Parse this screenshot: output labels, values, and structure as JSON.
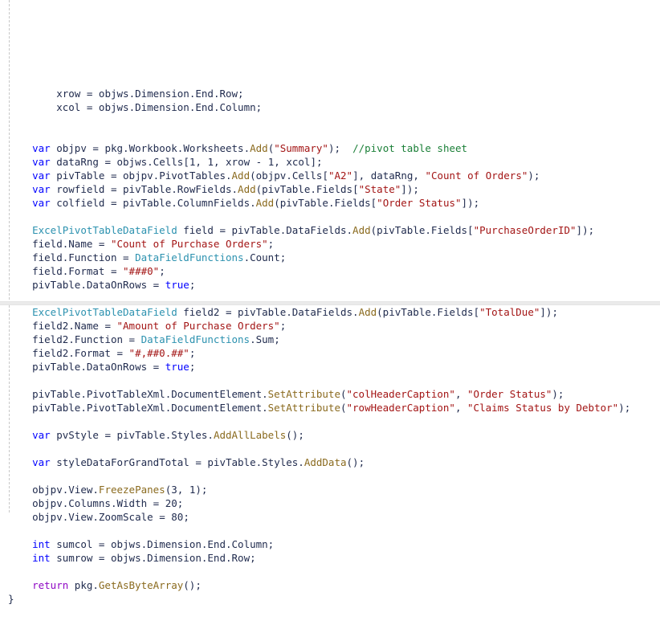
{
  "editor": {
    "language": "csharp",
    "background_color": "#ffffff",
    "indent_guide_color": "#c8c8c8",
    "region_divider_color": "#ebebeb",
    "colors": {
      "keyword": "#0000ff",
      "control_keyword": "#8f08c4",
      "type": "#2b91af",
      "method": "#8a6a1e",
      "string": "#a31515",
      "comment": "#1a7f37",
      "plain": "#1f2a4d"
    }
  },
  "code": {
    "lines": [
      {
        "id": "l1",
        "text": "        xrow = objws.Dimension.End.Row;"
      },
      {
        "id": "l2",
        "text": "        xcol = objws.Dimension.End.Column;"
      },
      {
        "id": "l3",
        "text": ""
      },
      {
        "id": "l4",
        "text": ""
      },
      {
        "id": "l5",
        "text": "    var objpv = pkg.Workbook.Worksheets.Add(\"Summary\");  //pivot table sheet"
      },
      {
        "id": "l6",
        "text": "    var dataRng = objws.Cells[1, 1, xrow - 1, xcol];"
      },
      {
        "id": "l7",
        "text": "    var pivTable = objpv.PivotTables.Add(objpv.Cells[\"A2\"], dataRng, \"Count of Orders\");"
      },
      {
        "id": "l8",
        "text": "    var rowfield = pivTable.RowFields.Add(pivTable.Fields[\"State\"]);"
      },
      {
        "id": "l9",
        "text": "    var colfield = pivTable.ColumnFields.Add(pivTable.Fields[\"Order Status\"]);"
      },
      {
        "id": "l10",
        "text": ""
      },
      {
        "id": "l11",
        "text": "    ExcelPivotTableDataField field = pivTable.DataFields.Add(pivTable.Fields[\"PurchaseOrderID\"]);"
      },
      {
        "id": "l12",
        "text": "    field.Name = \"Count of Purchase Orders\";"
      },
      {
        "id": "l13",
        "text": "    field.Function = DataFieldFunctions.Count;"
      },
      {
        "id": "l14",
        "text": "    field.Format = \"###0\";"
      },
      {
        "id": "l15",
        "text": "    pivTable.DataOnRows = true;"
      },
      {
        "id": "l16",
        "text": ""
      },
      {
        "id": "l17",
        "text": "    ExcelPivotTableDataField field2 = pivTable.DataFields.Add(pivTable.Fields[\"TotalDue\"]);"
      },
      {
        "id": "l18",
        "text": "    field2.Name = \"Amount of Purchase Orders\";"
      },
      {
        "id": "l19",
        "text": "    field2.Function = DataFieldFunctions.Sum;"
      },
      {
        "id": "l20",
        "text": "    field2.Format = \"#,##0.##\";"
      },
      {
        "id": "l21",
        "text": "    pivTable.DataOnRows = true;"
      },
      {
        "id": "l22",
        "text": ""
      },
      {
        "id": "l23",
        "text": "    pivTable.PivotTableXml.DocumentElement.SetAttribute(\"colHeaderCaption\", \"Order Status\");"
      },
      {
        "id": "l24",
        "text": "    pivTable.PivotTableXml.DocumentElement.SetAttribute(\"rowHeaderCaption\", \"Claims Status by Debtor\");"
      },
      {
        "id": "l25",
        "text": ""
      },
      {
        "id": "l26",
        "text": "    var pvStyle = pivTable.Styles.AddAllLabels();"
      },
      {
        "id": "l27",
        "text": ""
      },
      {
        "id": "l28",
        "text": "    var styleDataForGrandTotal = pivTable.Styles.AddData();"
      },
      {
        "id": "l29",
        "text": ""
      },
      {
        "id": "l30",
        "text": "    objpv.View.FreezePanes(3, 1);"
      },
      {
        "id": "l31",
        "text": "    objpv.Columns.Width = 20;"
      },
      {
        "id": "l32",
        "text": "    objpv.View.ZoomScale = 80;"
      },
      {
        "id": "l33",
        "text": ""
      },
      {
        "id": "l34",
        "text": "    int sumcol = objws.Dimension.End.Column;"
      },
      {
        "id": "l35",
        "text": "    int sumrow = objws.Dimension.End.Row;"
      },
      {
        "id": "l36",
        "text": ""
      },
      {
        "id": "l37",
        "text": "    return pkg.GetAsByteArray();"
      },
      {
        "id": "l38",
        "text": "}"
      }
    ],
    "keywords": [
      "var",
      "int",
      "true",
      "false",
      "new",
      "null",
      "string",
      "void",
      "this"
    ],
    "control_keywords": [
      "return",
      "if",
      "else",
      "for",
      "foreach",
      "while"
    ],
    "types": [
      "ExcelPivotTableDataField",
      "DataFieldFunctions"
    ],
    "methods": [
      "Add",
      "SetAttribute",
      "AddAllLabels",
      "AddData",
      "FreezePanes",
      "GetAsByteArray"
    ]
  }
}
